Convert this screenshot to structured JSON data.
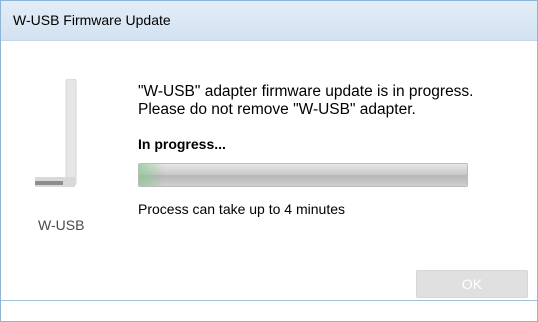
{
  "window": {
    "title": "W-USB Firmware Update"
  },
  "adapter": {
    "icon": "usb-adapter-icon",
    "label": "W-USB"
  },
  "message": {
    "line1": "\"W-USB\" adapter firmware update is in progress.",
    "line2": "Please do not remove \"W-USB\" adapter."
  },
  "progress": {
    "status_label": "In progress...",
    "value_fraction": 0.08,
    "note": "Process can take up to 4 minutes"
  },
  "buttons": {
    "ok_label": "OK",
    "ok_enabled": false
  },
  "colors": {
    "titlebar": "#d9e6f4",
    "window_border": "#8fb5d6",
    "progress_accent": "#82c88c",
    "disabled_button": "#e0e0e0"
  }
}
